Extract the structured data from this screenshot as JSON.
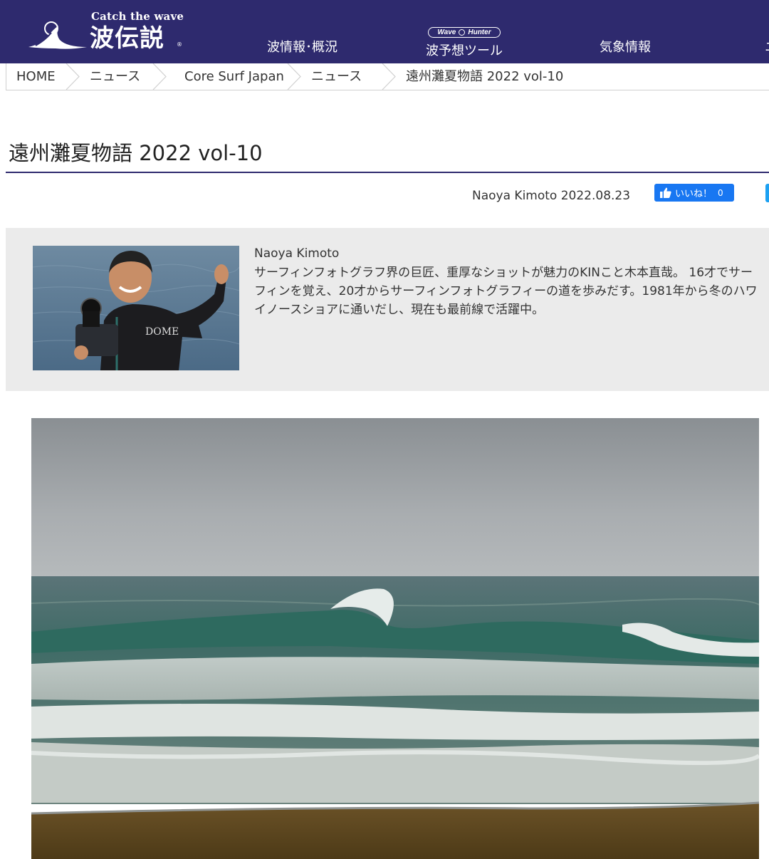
{
  "header": {
    "logo_tagline": "Catch the wave",
    "logo_text": "波伝説",
    "logo_reg": "®",
    "nav": [
      "波情報･概況",
      "波予想ツール",
      "気象情報",
      "ニ"
    ],
    "wave_hunter_badge": {
      "left": "Wave",
      "right": "Hunter"
    },
    "background_color": "#2e2a6e"
  },
  "breadcrumb": [
    "HOME",
    "ニュース",
    "Core Surf Japan",
    "ニュース",
    "遠州灘夏物語 2022 vol-10"
  ],
  "article": {
    "title": "遠州灘夏物語 2022 vol-10",
    "byline": "Naoya Kimoto 2022.08.23",
    "like_label": "いいね！",
    "like_count": "0"
  },
  "author": {
    "name": "Naoya Kimoto",
    "bio": "サーフィンフォトグラフ界の巨匠、重厚なショットが魅力のKINこと木本直哉。 16才でサーフィンを覚え、20才からサーフィンフォトグラフィーの道を歩みだす。1981年から冬のハワイノースショアに通いだし、現在も最前線で活躍中。",
    "photo_wetsuit_text": "DOME"
  },
  "colors": {
    "brand_navy": "#2e2a6e",
    "facebook_blue": "#1877f2",
    "author_box_bg": "#ebebeb"
  }
}
